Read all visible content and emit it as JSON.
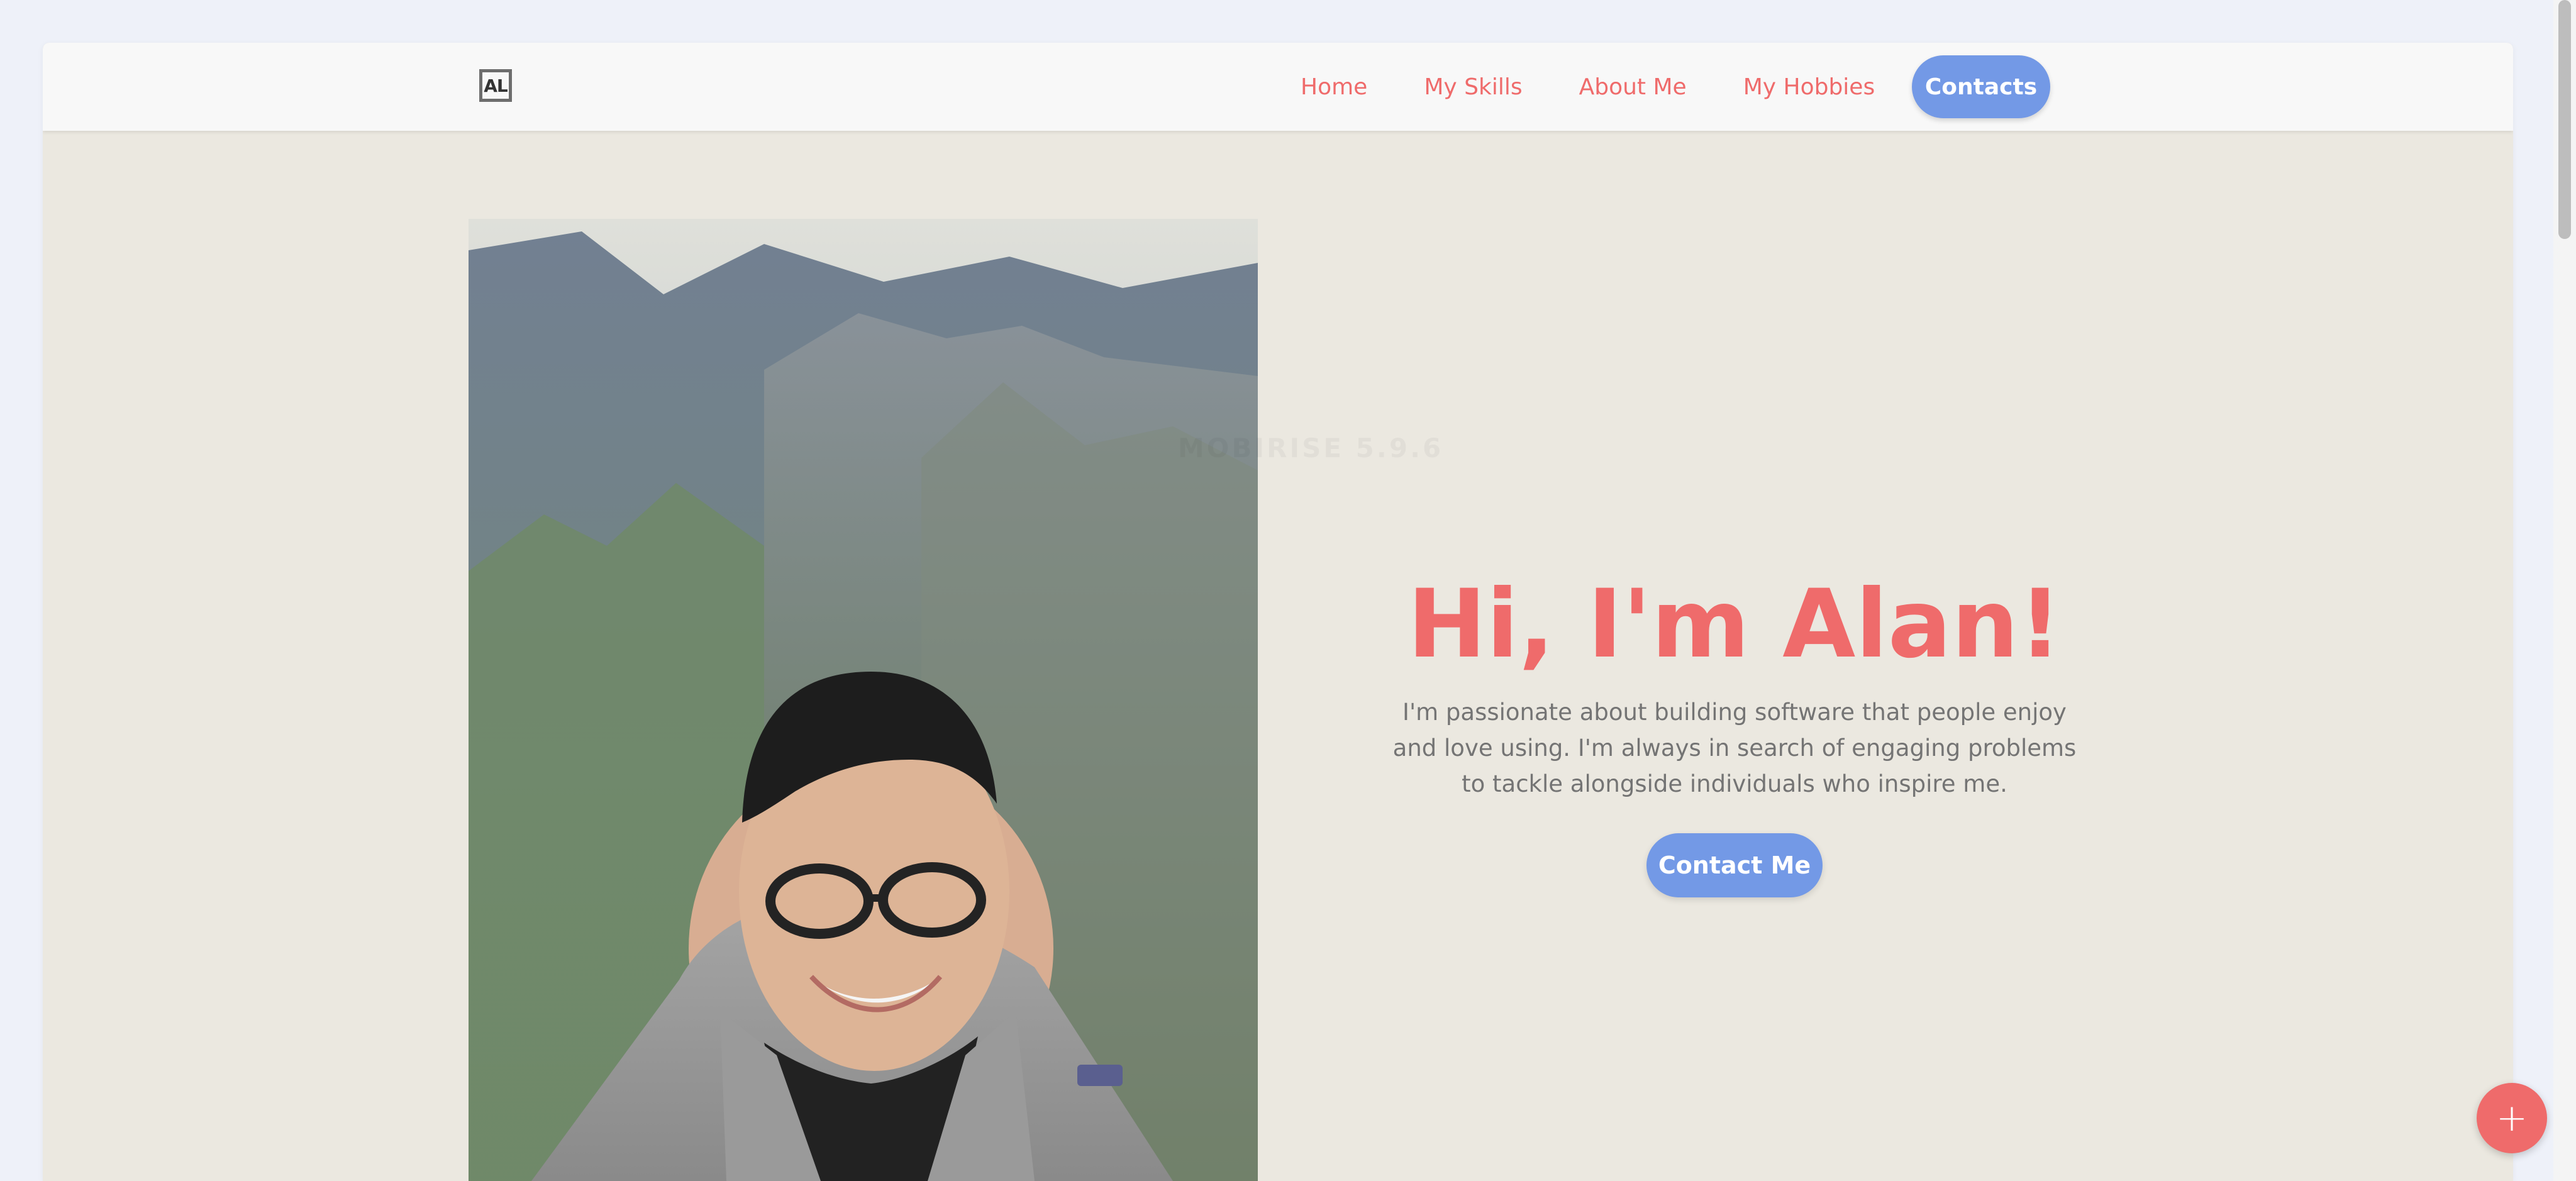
{
  "header": {
    "logo_text": "AL",
    "nav": [
      {
        "label": "Home"
      },
      {
        "label": "My Skills"
      },
      {
        "label": "About Me"
      },
      {
        "label": "My Hobbies"
      }
    ],
    "contact_label": "Contacts"
  },
  "hero": {
    "watermark": "MOBIRISE 5.9.6",
    "title": "Hi, I'm Alan!",
    "description": "I'm passionate about building software that people enjoy and love using. I'm always in search of engaging problems to tackle alongside individuals who inspire me.",
    "button_label": "Contact Me"
  },
  "fab": {
    "icon": "plus-icon",
    "symbol": "+"
  },
  "colors": {
    "accent": "#ef6b6b",
    "button": "#7399e6",
    "background": "#ebe8e0",
    "navbar": "#f8f8f8"
  }
}
